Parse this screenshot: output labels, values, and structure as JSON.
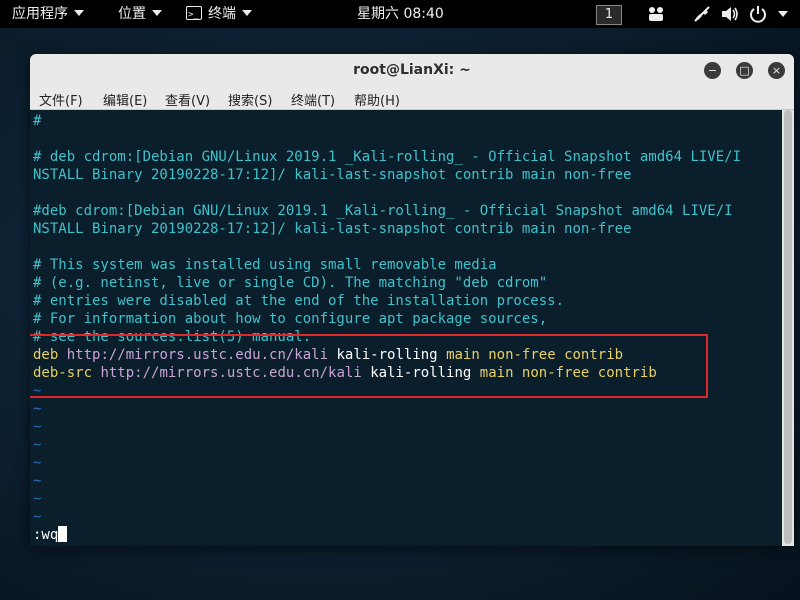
{
  "topbar": {
    "apps_label": "应用程序",
    "places_label": "位置",
    "terminal_label": "终端",
    "clock": "星期六 08:40",
    "workspace": "1"
  },
  "window": {
    "title": "root@LianXi: ~",
    "minimize": "−",
    "maximize": "□",
    "close": "×",
    "menu": [
      "文件(F)",
      "编辑(E)",
      "查看(V)",
      "搜索(S)",
      "终端(T)",
      "帮助(H)"
    ]
  },
  "terminal": {
    "lines": {
      "l0": "#",
      "l2": "# deb cdrom:[Debian GNU/Linux 2019.1 _Kali-rolling_ - Official Snapshot amd64 LIVE/I",
      "l3": "NSTALL Binary 20190228-17:12]/ kali-last-snapshot contrib main non-free",
      "l5": "#deb cdrom:[Debian GNU/Linux 2019.1 _Kali-rolling_ - Official Snapshot amd64 LIVE/I",
      "l6": "NSTALL Binary 20190228-17:12]/ kali-last-snapshot contrib main non-free",
      "l8": "# This system was installed using small removable media",
      "l9": "# (e.g. netinst, live or single CD). The matching \"deb cdrom\"",
      "l10": "# entries were disabled at the end of the installation process.",
      "l11": "# For information about how to configure apt package sources,",
      "l12": "# see the sources.list(5) manual."
    },
    "deb_line": {
      "type": "deb",
      "url": "http://mirrors.ustc.edu.cn/kali",
      "suite": "kali-rolling",
      "components": "main non-free contrib"
    },
    "debsrc_line": {
      "type": "deb-src",
      "url": "http://mirrors.ustc.edu.cn/kali",
      "suite": "kali-rolling",
      "components": "main non-free contrib"
    },
    "tilde": "~",
    "command": ":wq"
  },
  "colors": {
    "comment": "#3fc2cb",
    "keyword": "#e8d15f",
    "url": "#c9a3d4",
    "tilde": "#2f6fb5",
    "highlight_box": "#e02828"
  }
}
